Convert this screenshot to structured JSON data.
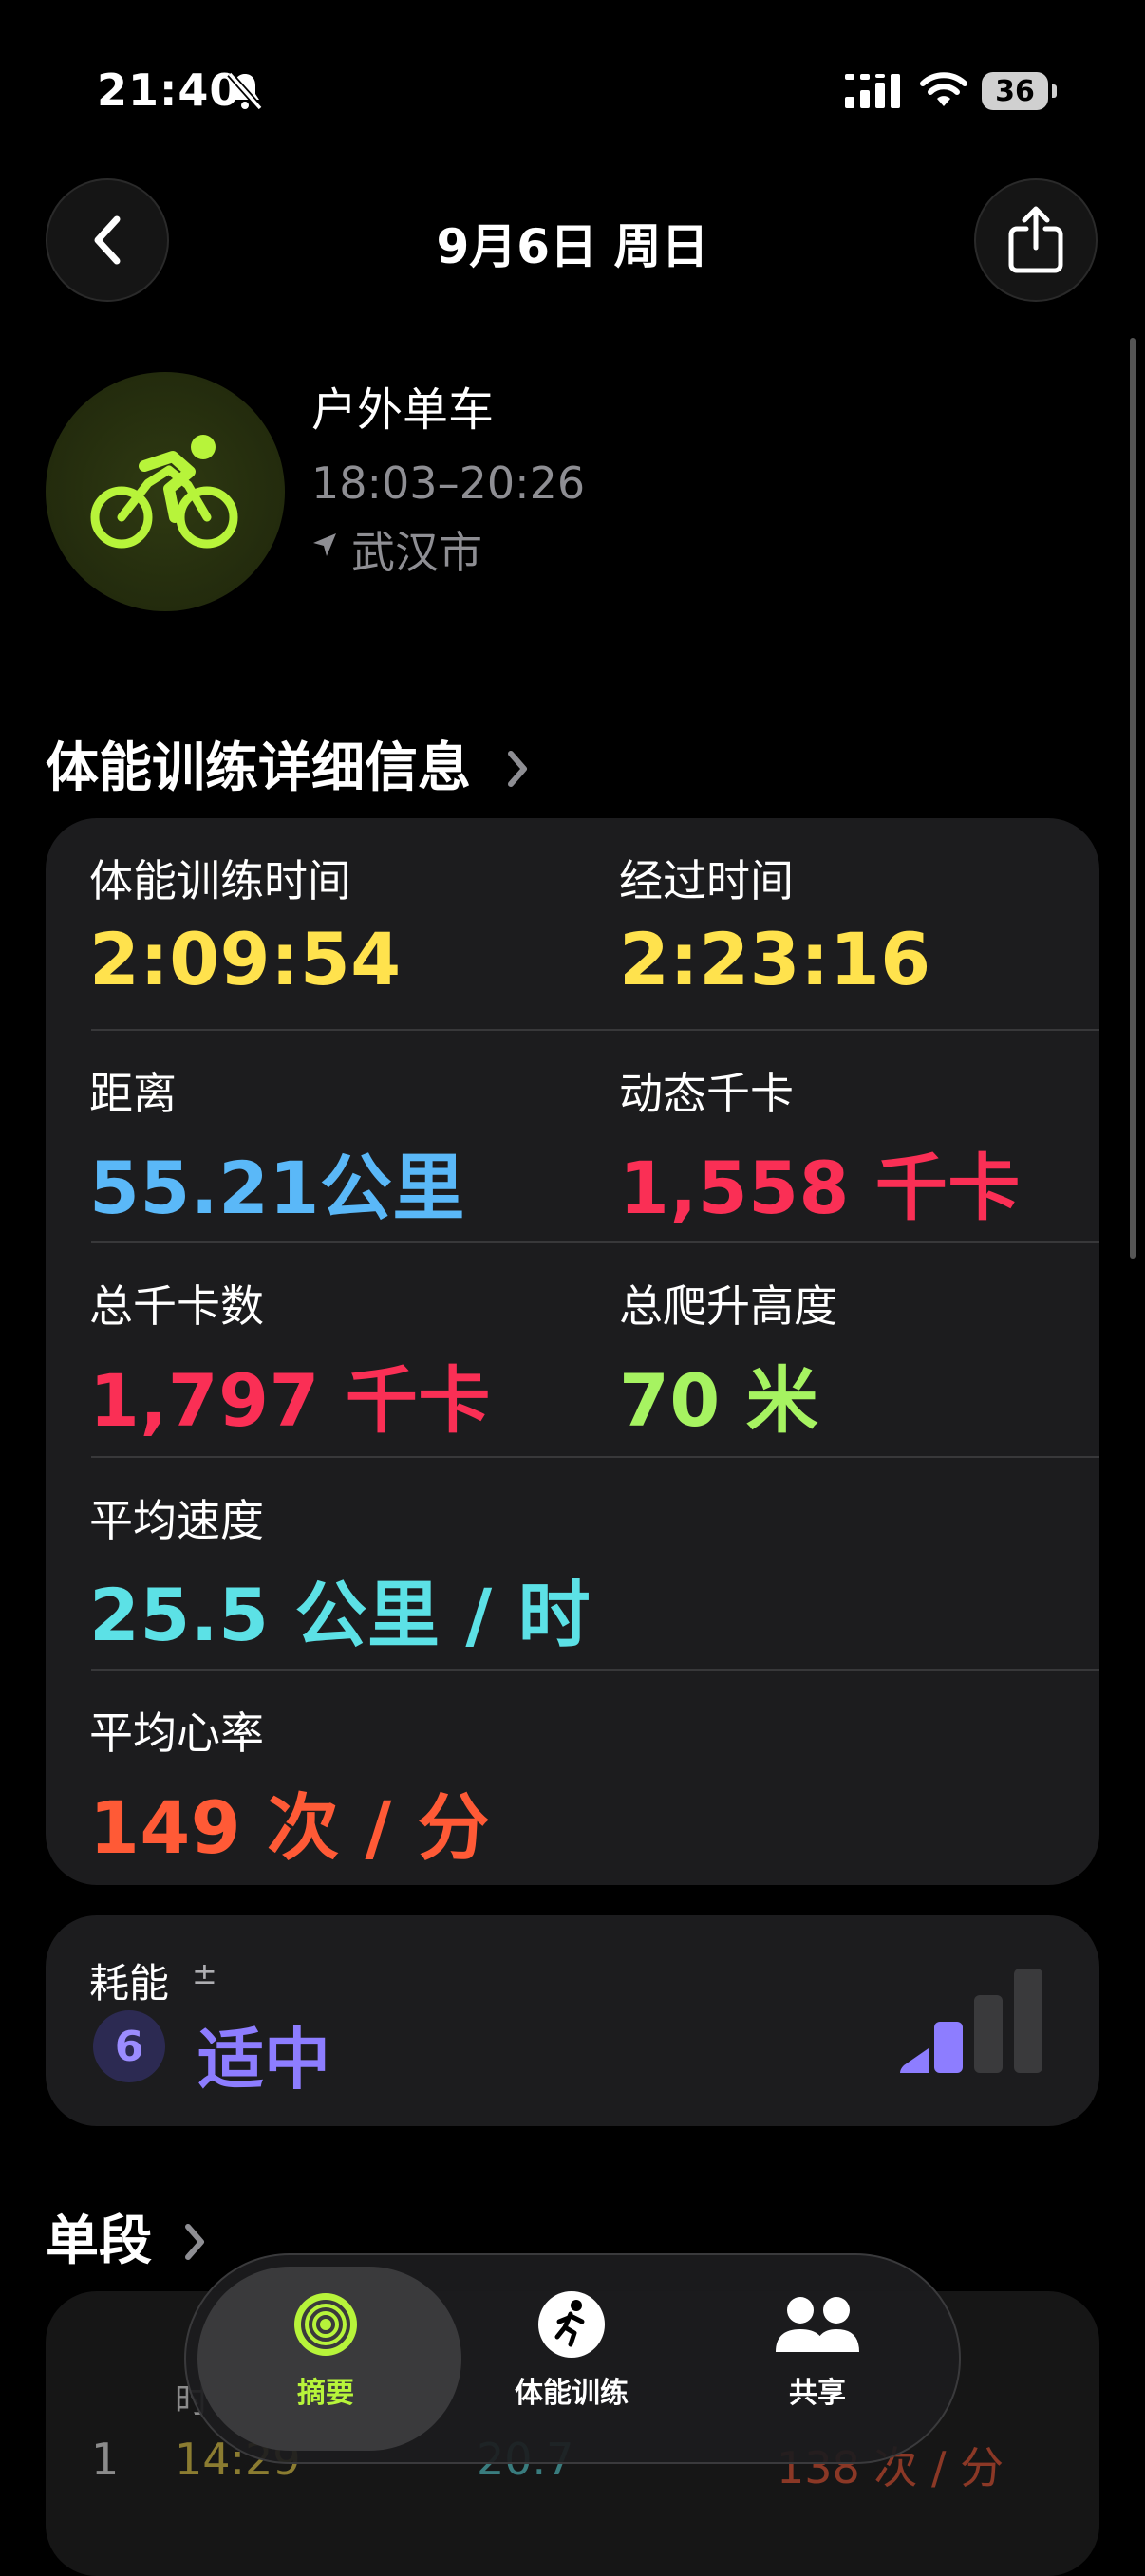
{
  "status_bar": {
    "time": "21:40",
    "battery": "36"
  },
  "header": {
    "title": "9月6日 周日"
  },
  "workout": {
    "name": "户外单车",
    "time_range": "18:03–20:26",
    "location": "武汉市"
  },
  "details": {
    "section_title": "体能训练详细信息",
    "metrics": [
      {
        "label": "体能训练时间",
        "value": "2:09:54",
        "color": "#FFE24D"
      },
      {
        "label": "经过时间",
        "value": "2:23:16",
        "color": "#FFE24D"
      },
      {
        "label": "距离",
        "value": "55.21公里",
        "color": "#5AB8F8"
      },
      {
        "label": "动态千卡",
        "value": "1,558 千卡",
        "color": "#FA2F55"
      },
      {
        "label": "总千卡数",
        "value": "1,797 千卡",
        "color": "#FA2F55"
      },
      {
        "label": "总爬升高度",
        "value": "70 米",
        "color": "#A6F361"
      },
      {
        "label": "平均速度",
        "value": "25.5 公里 / 时",
        "color": "#5CE1E6"
      },
      {
        "label": "平均心率",
        "value": "149 次 / 分",
        "color": "#FF5A36"
      }
    ]
  },
  "effort": {
    "label": "耗能",
    "plus_minus": "±",
    "score": "6",
    "level_text": "适中",
    "level": 2,
    "level_max": 4,
    "color": "#8D7DFF"
  },
  "splits": {
    "section_title": "单段",
    "header_partial": "时",
    "rows": [
      {
        "index": "1",
        "time": "14:29",
        "distance": "20.7",
        "heart_rate": "138 次 / 分"
      }
    ]
  },
  "tabbar": {
    "tabs": [
      {
        "label": "摘要",
        "selected": true
      },
      {
        "label": "体能训练",
        "selected": false
      },
      {
        "label": "共享",
        "selected": false
      }
    ]
  },
  "colors": {
    "accent": "#B7F43A",
    "card": "#1C1C1E"
  }
}
